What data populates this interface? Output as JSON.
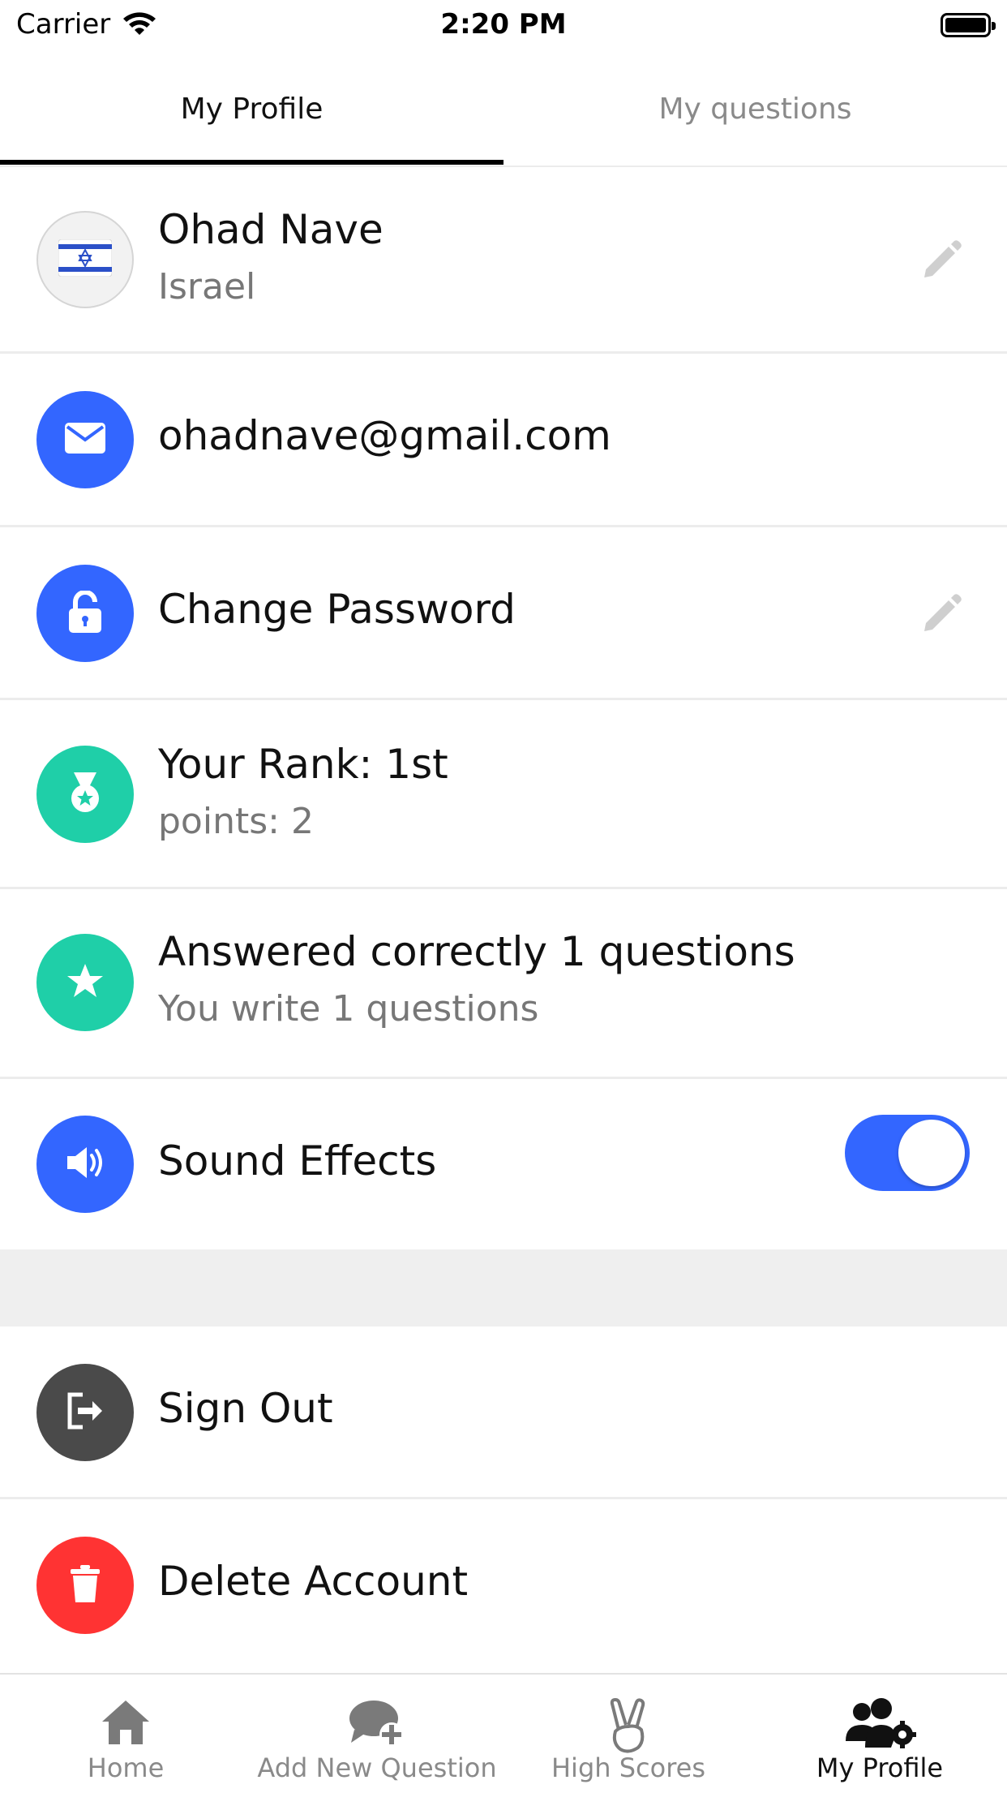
{
  "status_bar": {
    "carrier": "Carrier",
    "time": "2:20 PM"
  },
  "tabs": [
    {
      "label": "My Profile",
      "active": true
    },
    {
      "label": "My questions",
      "active": false
    }
  ],
  "profile": {
    "name": "Ohad Nave",
    "country": "Israel",
    "flag_icon": "israel-flag-icon"
  },
  "email": {
    "value": "ohadnave@gmail.com",
    "icon": "envelope-icon"
  },
  "password": {
    "label": "Change Password",
    "icon": "lock-icon"
  },
  "rank": {
    "title": "Your Rank: 1st",
    "points": "points: 2",
    "icon": "medal-icon"
  },
  "answers": {
    "title": "Answered correctly 1 questions",
    "written": "You write 1 questions",
    "icon": "star-icon"
  },
  "sound": {
    "label": "Sound Effects",
    "enabled": true,
    "icon": "speaker-icon"
  },
  "signout": {
    "label": "Sign Out",
    "icon": "sign-out-icon"
  },
  "delete": {
    "label": "Delete Account",
    "icon": "trash-icon"
  },
  "bottom_nav": [
    {
      "label": "Home",
      "icon": "home-icon",
      "active": false
    },
    {
      "label": "Add New Question",
      "icon": "add-comment-icon",
      "active": false
    },
    {
      "label": "High Scores",
      "icon": "victory-hand-icon",
      "active": false
    },
    {
      "label": "My Profile",
      "icon": "user-settings-icon",
      "active": true
    }
  ],
  "colors": {
    "accent_blue": "#3366ff",
    "accent_teal": "#1fcfa8",
    "signout_gray": "#4a4a4a",
    "delete_red": "#ff3333",
    "inactive_text": "#8a8a8a"
  }
}
